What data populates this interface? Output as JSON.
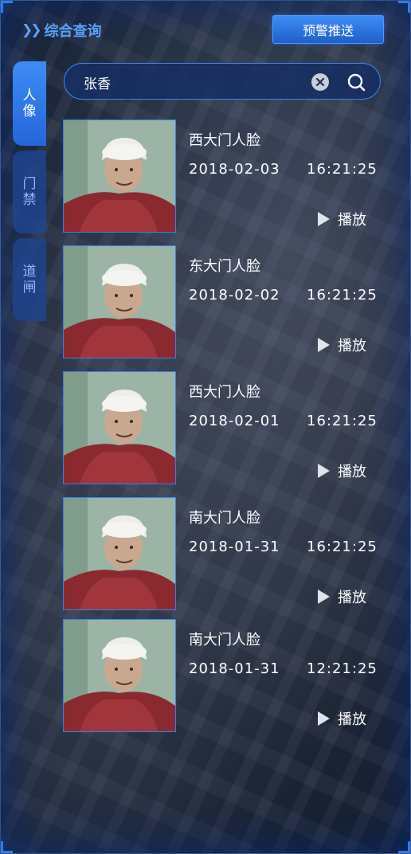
{
  "header": {
    "title": "综合查询",
    "push_button": "预警推送"
  },
  "tabs": [
    {
      "label": "人像",
      "active": true
    },
    {
      "label": "门禁",
      "active": false
    },
    {
      "label": "道闸",
      "active": false
    }
  ],
  "search": {
    "value": "张香"
  },
  "results": [
    {
      "location": "西大门人脸",
      "date": "2018-02-03",
      "time": "16:21:25",
      "play_label": "播放"
    },
    {
      "location": "东大门人脸",
      "date": "2018-02-02",
      "time": "16:21:25",
      "play_label": "播放"
    },
    {
      "location": "西大门人脸",
      "date": "2018-02-01",
      "time": "16:21:25",
      "play_label": "播放"
    },
    {
      "location": "南大门人脸",
      "date": "2018-01-31",
      "time": "16:21:25",
      "play_label": "播放"
    },
    {
      "location": "南大门人脸",
      "date": "2018-01-31",
      "time": "12:21:25",
      "play_label": "播放"
    }
  ],
  "colors": {
    "accent": "#3e8bf6",
    "title": "#5aa2ff",
    "border": "#3a84f0"
  },
  "icons": {
    "header": "double-chevron-right-icon",
    "clear": "clear-circle-icon",
    "search": "search-icon",
    "play": "play-triangle-icon",
    "thumbnail": "face-photo-icon"
  }
}
